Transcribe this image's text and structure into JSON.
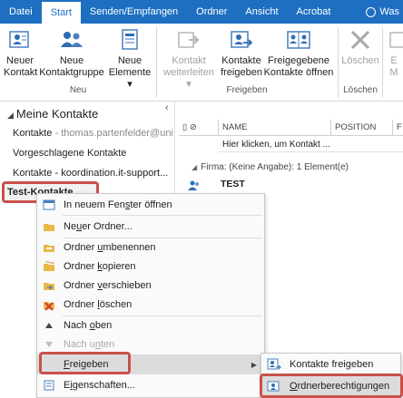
{
  "tabs": [
    "Datei",
    "Start",
    "Senden/Empfangen",
    "Ordner",
    "Ansicht",
    "Acrobat"
  ],
  "search_hint": "Was",
  "colors": {
    "tabbar": "#1e6fc1",
    "highlight": "#c9504a",
    "icon_blue": "#2e6db4"
  },
  "ribbon": {
    "new_contact": [
      "Neuer",
      "Kontakt"
    ],
    "new_group": [
      "Neue",
      "Kontaktgruppe"
    ],
    "new_items": [
      "Neue",
      "Elemente ▾"
    ],
    "group_new": "Neu",
    "forward": [
      "Kontakt",
      "weiterleiten ▾"
    ],
    "share": [
      "Kontakte",
      "freigeben"
    ],
    "open_shared": [
      "Freigegebene",
      "Kontakte öffnen"
    ],
    "group_share": "Freigeben",
    "delete": "Löschen",
    "group_delete": "Löschen",
    "partial": [
      "E",
      "M"
    ]
  },
  "nav": {
    "collapse": "‹",
    "root": "Meine Kontakte",
    "items": [
      {
        "label": "Kontakte",
        "extra": " - thomas.partenfelder@uni..."
      },
      {
        "label": "Vorgeschlagene Kontakte",
        "extra": ""
      },
      {
        "label": "Kontakte - koordination.it-support...",
        "extra": ""
      },
      {
        "label": "Test-Kontakte",
        "extra": ""
      }
    ]
  },
  "list": {
    "col_name": "NAME",
    "col_position": "POSITION",
    "col_f": "F",
    "click_row": "Hier klicken, um Kontakt ...",
    "group_header": "Firma: (Keine Angabe): 1 Element(e)",
    "contact_name": "TEST"
  },
  "context_menu": {
    "open_new_window": {
      "pre": "In neuem Fen",
      "u": "s",
      "post": "ter öffnen"
    },
    "new_folder": {
      "pre": "Ne",
      "u": "u",
      "post": "er Ordner..."
    },
    "rename": {
      "pre": "Ordner ",
      "u": "u",
      "post": "mbenennen"
    },
    "copy": {
      "pre": "Ordner ",
      "u": "k",
      "post": "opieren"
    },
    "move": {
      "pre": "Ordner ",
      "u": "v",
      "post": "erschieben"
    },
    "delete": {
      "pre": "Ordner ",
      "u": "l",
      "post": "öschen"
    },
    "move_up": {
      "pre": "Nach ",
      "u": "o",
      "post": "ben"
    },
    "move_down": {
      "pre": "Nach u",
      "u": "n",
      "post": "ten"
    },
    "share": {
      "pre": "",
      "u": "F",
      "post": "reigeben"
    },
    "properties": {
      "pre": "E",
      "u": "i",
      "post": "genschaften..."
    }
  },
  "submenu": {
    "share_contacts": "Kontakte freigeben",
    "folder_permissions": {
      "pre": "",
      "u": "O",
      "post": "rdnerberechtigungen"
    }
  }
}
